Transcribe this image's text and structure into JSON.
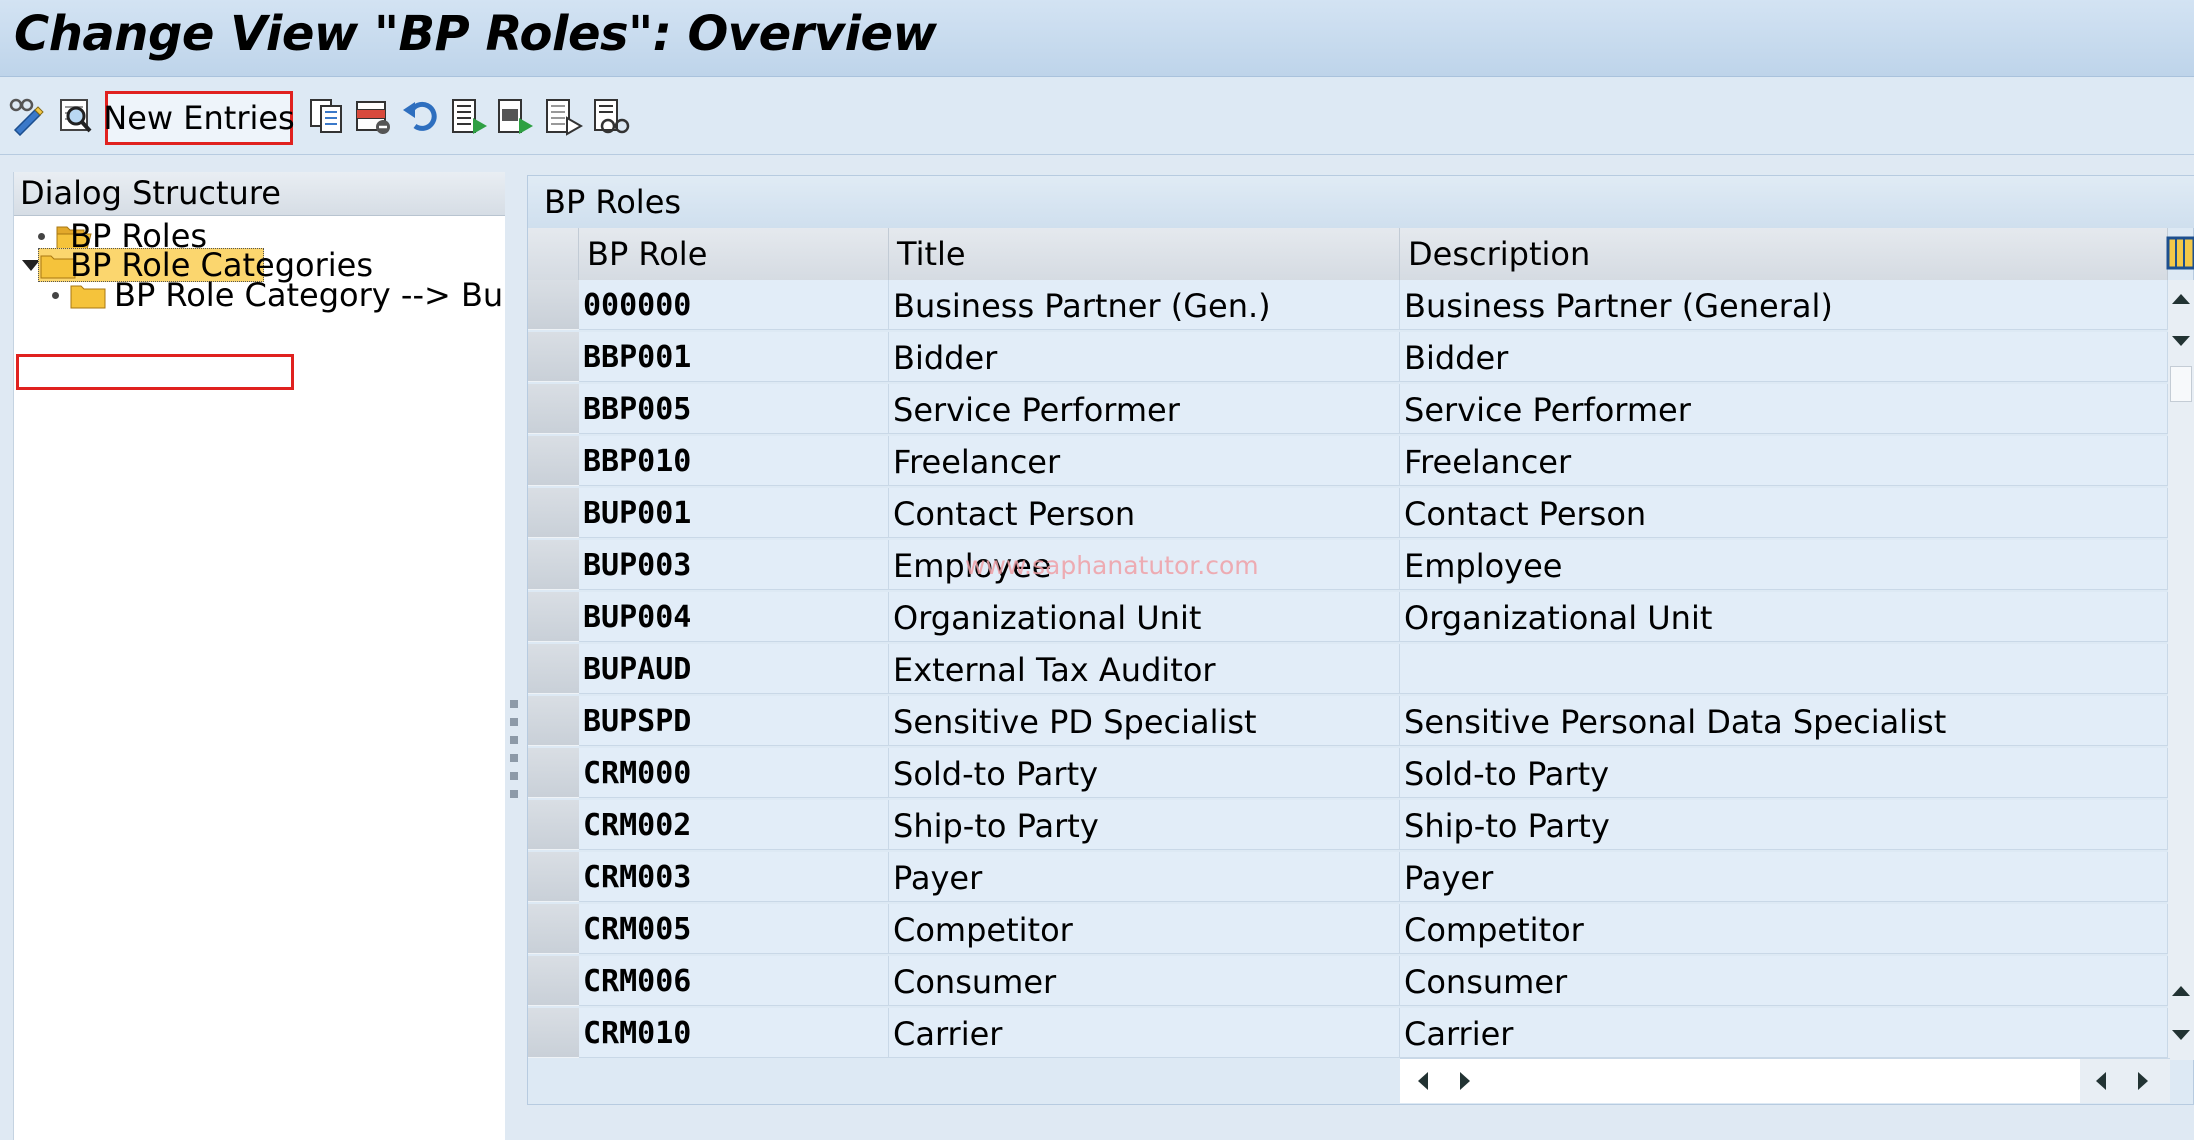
{
  "title": "Change View \"BP Roles\": Overview",
  "toolbar": {
    "new_entries_label": "New Entries",
    "icons": [
      "display-change-icon",
      "find-icon",
      "copy-icon",
      "delete-icon",
      "undo-icon",
      "select-all-icon",
      "select-block-icon",
      "deselect-all-icon",
      "variants-icon"
    ]
  },
  "dialog_structure": {
    "header": "Dialog Structure",
    "items": [
      {
        "label": "BP Roles",
        "expanded": false
      },
      {
        "label": "BP Role Categories",
        "expanded": true,
        "selected": true
      },
      {
        "label": "BP Role Category --> Busin",
        "expanded": false
      }
    ]
  },
  "table": {
    "title": "BP Roles",
    "columns": [
      "BP Role",
      "Title",
      "Description"
    ],
    "rows": [
      {
        "code": "000000",
        "title": "Business Partner (Gen.)",
        "desc": "Business Partner (General)"
      },
      {
        "code": "BBP001",
        "title": "Bidder",
        "desc": "Bidder"
      },
      {
        "code": "BBP005",
        "title": "Service Performer",
        "desc": "Service Performer"
      },
      {
        "code": "BBP010",
        "title": "Freelancer",
        "desc": "Freelancer"
      },
      {
        "code": "BUP001",
        "title": "Contact Person",
        "desc": "Contact Person"
      },
      {
        "code": "BUP003",
        "title": "Employee",
        "desc": "Employee"
      },
      {
        "code": "BUP004",
        "title": "Organizational Unit",
        "desc": "Organizational Unit"
      },
      {
        "code": "BUPAUD",
        "title": "External Tax Auditor",
        "desc": ""
      },
      {
        "code": "BUPSPD",
        "title": "Sensitive PD Specialist",
        "desc": "Sensitive Personal Data Specialist"
      },
      {
        "code": "CRM000",
        "title": "Sold-to Party",
        "desc": "Sold-to Party"
      },
      {
        "code": "CRM002",
        "title": "Ship-to Party",
        "desc": "Ship-to Party"
      },
      {
        "code": "CRM003",
        "title": "Payer",
        "desc": "Payer"
      },
      {
        "code": "CRM005",
        "title": "Competitor",
        "desc": "Competitor"
      },
      {
        "code": "CRM006",
        "title": "Consumer",
        "desc": "Consumer"
      },
      {
        "code": "CRM010",
        "title": "Carrier",
        "desc": "Carrier"
      }
    ]
  },
  "watermark": "www.saphanatutor.com",
  "colors": {
    "highlight_border": "#e0211f",
    "folder": "#f5c33b",
    "selection": "#fbd66e"
  }
}
